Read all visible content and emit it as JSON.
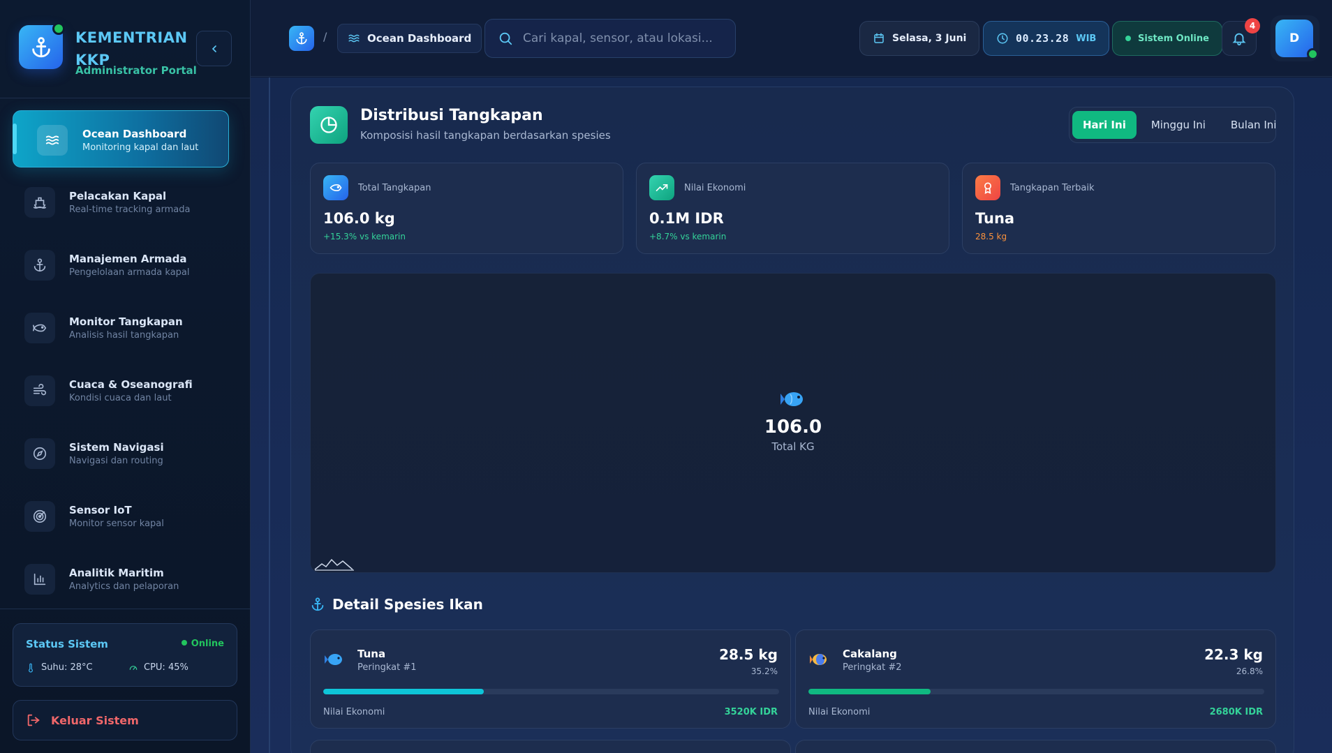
{
  "sidebar": {
    "brand_title": "KEMENTRIAN KKP",
    "brand_sub": "Administrator Portal",
    "items": [
      {
        "label": "Ocean Dashboard",
        "sub": "Monitoring kapal dan laut",
        "icon": "waves-icon",
        "active": true
      },
      {
        "label": "Pelacakan Kapal",
        "sub": "Real-time tracking armada",
        "icon": "ship-icon"
      },
      {
        "label": "Manajemen Armada",
        "sub": "Pengelolaan armada kapal",
        "icon": "anchor-icon"
      },
      {
        "label": "Monitor Tangkapan",
        "sub": "Analisis hasil tangkapan",
        "icon": "fish-icon"
      },
      {
        "label": "Cuaca & Oseanografi",
        "sub": "Kondisi cuaca dan laut",
        "icon": "wind-icon"
      },
      {
        "label": "Sistem Navigasi",
        "sub": "Navigasi dan routing",
        "icon": "compass-icon"
      },
      {
        "label": "Sensor IoT",
        "sub": "Monitor sensor kapal",
        "icon": "radar-icon"
      },
      {
        "label": "Analitik Maritim",
        "sub": "Analytics dan pelaporan",
        "icon": "bar-chart-icon"
      }
    ],
    "status": {
      "title": "Status Sistem",
      "state": "Online",
      "temp": "Suhu: 28°C",
      "cpu": "CPU: 45%"
    },
    "logout_label": "Keluar Sistem"
  },
  "header": {
    "breadcrumb_current": "Ocean Dashboard",
    "breadcrumb_sep": "/",
    "search_placeholder": "Cari kapal, sensor, atau lokasi...",
    "date": "Selasa, 3 Juni",
    "time": "00.23.28",
    "timezone": "WIB",
    "system_status": "Sistem Online",
    "notification_count": "4",
    "avatar_initial": "D"
  },
  "panel": {
    "title": "Distribusi Tangkapan",
    "subtitle": "Komposisi hasil tangkapan berdasarkan spesies",
    "ranges": [
      "Hari Ini",
      "Minggu Ini",
      "Bulan Ini"
    ],
    "active_range": "Hari Ini",
    "kpis": [
      {
        "label": "Total Tangkapan",
        "value": "106.0 kg",
        "delta": "+15.3% vs kemarin",
        "color": "#38b6f5"
      },
      {
        "label": "Nilai Ekonomi",
        "value": "0.1M IDR",
        "delta": "+8.7% vs kemarin",
        "color": "#10b981"
      },
      {
        "label": "Tangkapan Terbaik",
        "value": "Tuna",
        "delta": "28.5 kg",
        "color": "#f97316"
      }
    ],
    "center_value": "106.0",
    "center_label": "Total KG",
    "section_title": "Detail Spesies Ikan",
    "species": [
      {
        "name": "Tuna",
        "rank": "Peringkat #1",
        "kg": "28.5 kg",
        "pct": "35.2%",
        "share": 0.352,
        "eco_label": "Nilai Ekonomi",
        "eco_value": "3520K IDR",
        "bar_color": "#0ec5d8"
      },
      {
        "name": "Cakalang",
        "rank": "Peringkat #2",
        "kg": "22.3 kg",
        "pct": "26.8%",
        "share": 0.268,
        "eco_label": "Nilai Ekonomi",
        "eco_value": "2680K IDR",
        "bar_color": "#10b981"
      }
    ]
  },
  "colors": {
    "accent": "#38b6f5",
    "success": "#22c55e",
    "teal": "#10b981",
    "danger": "#ef4444",
    "orange": "#f97316"
  }
}
